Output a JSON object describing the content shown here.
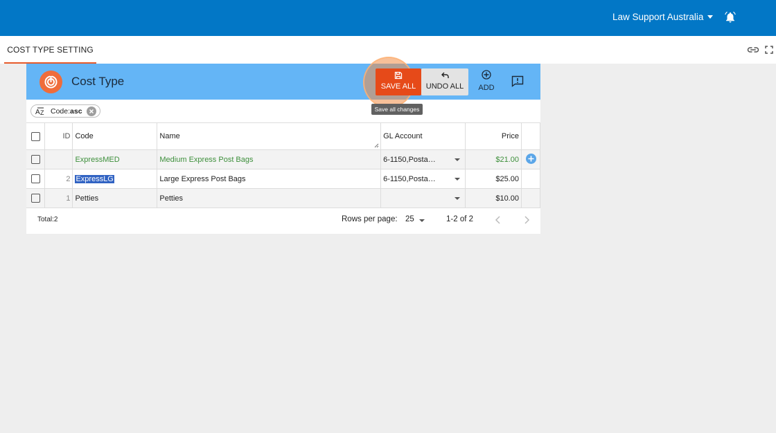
{
  "header": {
    "org_name": "Law Support Australia",
    "icons": [
      "bell-icon",
      "moon-icon",
      "chevron-down-icon"
    ]
  },
  "tabs": [
    {
      "label": "COST TYPE SETTING",
      "active": true
    }
  ],
  "tab_actions": {
    "icons": [
      "link-icon",
      "fullscreen-icon"
    ]
  },
  "card": {
    "title": "Cost Type",
    "toolbar": {
      "save_all": "SAVE ALL",
      "undo_all": "UNDO ALL",
      "add": "ADD",
      "save_tooltip": "Save all changes"
    },
    "sort_chip": {
      "field": "Code:",
      "direction": "asc"
    }
  },
  "table": {
    "columns": [
      "ID",
      "Code",
      "Name",
      "GL Account",
      "Price"
    ],
    "rows": [
      {
        "id": "",
        "code": "ExpressMED",
        "name": "Medium Express Post Bags",
        "gl_account": "6-1150,Posta…",
        "price": "$21.00",
        "state": "new"
      },
      {
        "id": "2",
        "code": "ExpressLG",
        "name": "Large Express Post Bags",
        "gl_account": "6-1150,Posta…",
        "price": "$25.00",
        "state": "editing"
      },
      {
        "id": "1",
        "code": "Petties",
        "name": "Petties",
        "gl_account": "",
        "price": "$10.00",
        "state": "normal"
      }
    ]
  },
  "footer": {
    "total": "Total:2",
    "rows_per_page_label": "Rows per page:",
    "rows_per_page_value": "25",
    "range": "1-2 of 2"
  },
  "colors": {
    "topbar": "#0277c6",
    "card_header": "#64b5f6",
    "save_button": "#e64a19",
    "new_row_text": "#3d8f3b",
    "tab_underline": "#e65a2a"
  }
}
